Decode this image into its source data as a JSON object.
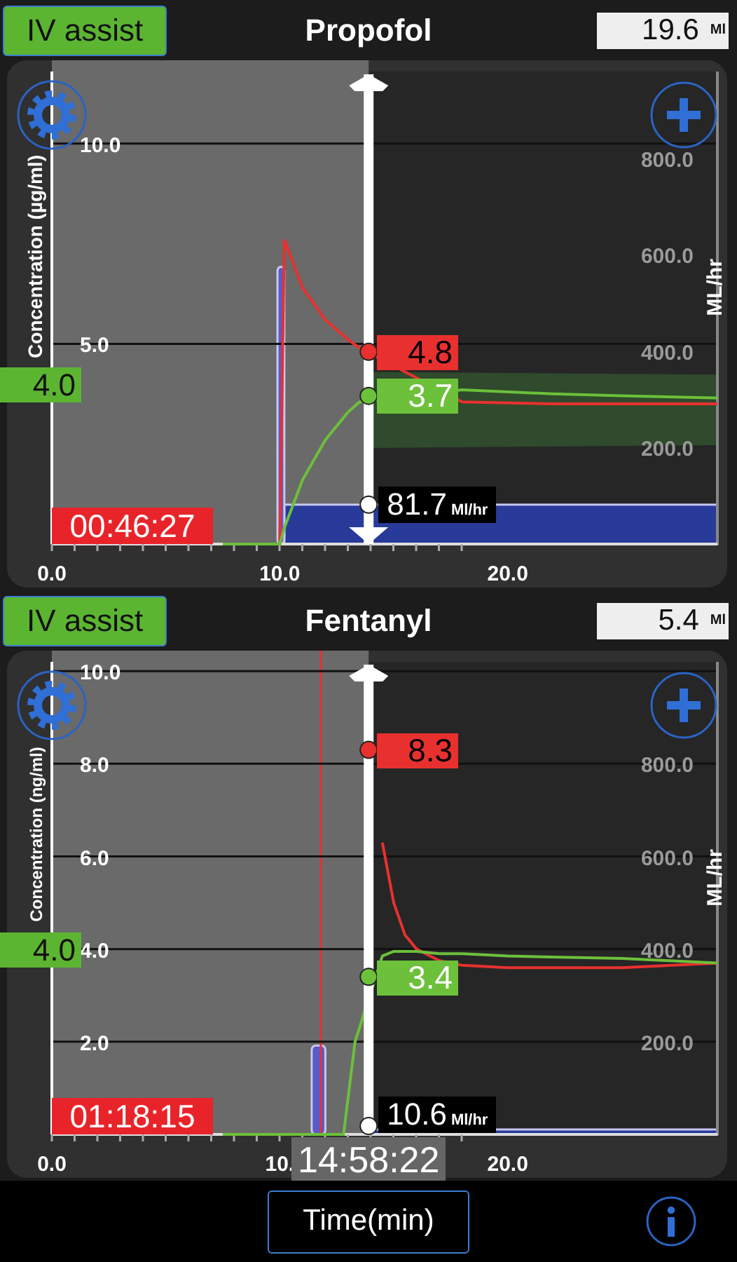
{
  "panels": [
    {
      "assist_button": "IV assist",
      "drug": "Propofol",
      "volume": "19.6",
      "volume_unit": "Ml",
      "target": "4.0",
      "timer": "00:46:27",
      "readings": [
        "4.8",
        "3.7"
      ],
      "rate_reading": "81.7",
      "rate_unit": "Ml/hr",
      "chart_data": {
        "type": "line",
        "ylabel": "Concentration (µg/ml)",
        "y2label": "ML/hr",
        "grid": true,
        "xlim": [
          0,
          29.2
        ],
        "ylim": [
          0,
          11.8
        ],
        "y2lim": [
          0,
          980
        ],
        "xticks": [
          {
            "value": 0,
            "label": "0.0"
          },
          {
            "value": 10,
            "label": "10.0"
          },
          {
            "value": 20,
            "label": "20.0"
          }
        ],
        "yticks": [
          {
            "value": 5,
            "label": "5.0"
          },
          {
            "value": 10,
            "label": "10.0"
          }
        ],
        "y2ticks": [
          {
            "value": 200,
            "label": "200.0"
          },
          {
            "value": 400,
            "label": "400.0"
          },
          {
            "value": 600,
            "label": "600.0"
          },
          {
            "value": 800,
            "label": "800.0"
          }
        ],
        "x": [
          7.5,
          10,
          10.2,
          11,
          12,
          13,
          13.5,
          18,
          22,
          25,
          29.2
        ],
        "series": [
          {
            "color": "#e8312f",
            "values": [
              0,
              0,
              7.6,
              6.4,
              5.6,
              5.1,
              4.9,
              3.55,
              3.5,
              3.5,
              3.5
            ]
          },
          {
            "color": "#6cc03a",
            "values": [
              0,
              0,
              0.4,
              1.6,
              2.6,
              3.3,
              3.55,
              3.85,
              3.75,
              3.7,
              3.65
            ]
          }
        ]
      }
    },
    {
      "assist_button": "IV assist",
      "drug": "Fentanyl",
      "volume": "5.4",
      "volume_unit": "Ml",
      "target": "4.0",
      "timer": "01:18:15",
      "readings": [
        "8.3",
        "3.4"
      ],
      "rate_reading": "10.6",
      "rate_unit": "Ml/hr",
      "clock": "14:58:22",
      "chart_data": {
        "type": "line",
        "ylabel": "Concentration (ng/ml)",
        "y2label": "ML/hr",
        "grid": true,
        "xlim": [
          0,
          29.2
        ],
        "ylim": [
          0,
          10.2
        ],
        "y2lim": [
          0,
          1020
        ],
        "xticks": [
          {
            "value": 0,
            "label": "0.0"
          },
          {
            "value": 10,
            "label": "10."
          },
          {
            "value": 20,
            "label": "20.0"
          }
        ],
        "yticks": [
          {
            "value": 2,
            "label": "2.0"
          },
          {
            "value": 4,
            "label": "4.0"
          },
          {
            "value": 6,
            "label": "6.0"
          },
          {
            "value": 8,
            "label": "8.0"
          },
          {
            "value": 10,
            "label": "10.0"
          }
        ],
        "y2ticks": [
          {
            "value": 200,
            "label": "200.0"
          },
          {
            "value": 400,
            "label": "400.0"
          },
          {
            "value": 600,
            "label": "600.0"
          },
          {
            "value": 800,
            "label": "800.0"
          }
        ],
        "x": [
          7.5,
          12.8,
          13.3,
          14.5,
          15,
          15.5,
          16,
          17,
          18,
          20,
          25,
          29.2
        ],
        "series": [
          {
            "color": "#e8312f",
            "values": [
              0,
              0,
              null,
              6.3,
              5.0,
              4.3,
              4.0,
              3.75,
              3.65,
              3.6,
              3.6,
              3.7
            ]
          },
          {
            "color": "#6cc03a",
            "values": [
              0,
              0,
              2.0,
              3.85,
              3.95,
              3.95,
              3.95,
              3.9,
              3.9,
              3.85,
              3.8,
              3.7
            ]
          }
        ]
      }
    }
  ],
  "footer": {
    "axis_button": "Time(min)"
  }
}
